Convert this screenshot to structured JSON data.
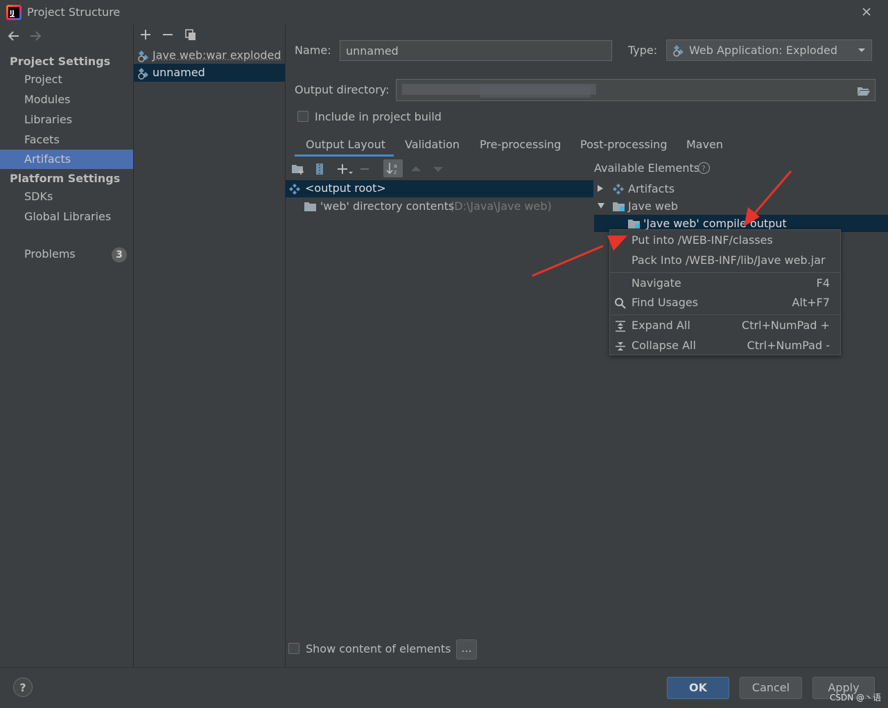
{
  "window": {
    "title": "Project Structure"
  },
  "nav": {
    "project_settings_header": "Project Settings",
    "project_items": [
      "Project",
      "Modules",
      "Libraries",
      "Facets",
      "Artifacts"
    ],
    "selected": "Artifacts",
    "platform_settings_header": "Platform Settings",
    "platform_items": [
      "SDKs",
      "Global Libraries"
    ],
    "problems_label": "Problems",
    "problems_count": "3"
  },
  "artifacts": {
    "items": [
      "Jave web:war exploded",
      "unnamed"
    ],
    "selected": "unnamed"
  },
  "form": {
    "name_label": "Name:",
    "name_value": "unnamed",
    "type_label": "Type:",
    "type_value": "Web Application: Exploded",
    "output_dir_label": "Output directory:",
    "include_build_label": "Include in project build",
    "include_build_checked": false
  },
  "tabs": [
    "Output Layout",
    "Validation",
    "Pre-processing",
    "Post-processing",
    "Maven"
  ],
  "active_tab": "Output Layout",
  "output_tree": {
    "root": "<output root>",
    "child_label": "'web' directory contents",
    "child_path": "(D:\\Java\\Jave web)"
  },
  "available": {
    "header": "Available Elements",
    "artifacts": "Artifacts",
    "module": "Jave web",
    "compile_output": "'Jave web' compile output"
  },
  "context_menu": {
    "items": [
      {
        "label": "Put into /WEB-INF/classes",
        "shortcut": ""
      },
      {
        "label": "Pack Into /WEB-INF/lib/Jave web.jar",
        "shortcut": ""
      },
      {
        "label": "Navigate",
        "shortcut": "F4"
      },
      {
        "label": "Find Usages",
        "shortcut": "Alt+F7"
      },
      {
        "label": "Expand All",
        "shortcut": "Ctrl+NumPad +"
      },
      {
        "label": "Collapse All",
        "shortcut": "Ctrl+NumPad -"
      }
    ]
  },
  "footer": {
    "show_content_label": "Show content of elements",
    "dots_label": "...",
    "help_label": "?",
    "ok_label": "OK",
    "cancel_label": "Cancel",
    "apply_label": "Apply",
    "watermark": "CSDN @丶语"
  },
  "colors": {
    "background": "#3c3f41",
    "selection_blue": "#4b6eaf",
    "tree_selection": "#0d293e",
    "annotation_red": "#e8332a",
    "ok_button": "#365880"
  }
}
